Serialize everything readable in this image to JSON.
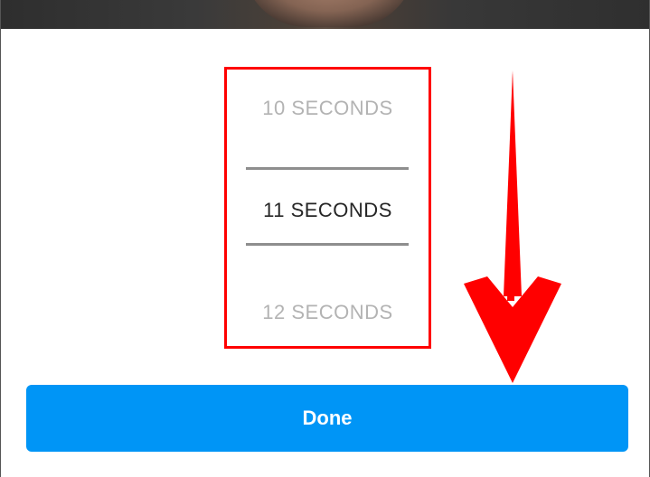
{
  "picker": {
    "options": [
      {
        "label": "10 SECONDS",
        "state": "dim"
      },
      {
        "label": "11 SECONDS",
        "state": "selected"
      },
      {
        "label": "12 SECONDS",
        "state": "dim"
      }
    ],
    "selected_label": "11 SECONDS"
  },
  "actions": {
    "done_label": "Done"
  },
  "annotations": {
    "highlight_color": "#ff0000",
    "arrow_color": "#ff0000",
    "arrow_direction": "down"
  },
  "colors": {
    "button_primary": "#0095f6",
    "selected_text": "#262626",
    "dim_text": "#b3b3b3",
    "divider": "#8e8e8e"
  }
}
